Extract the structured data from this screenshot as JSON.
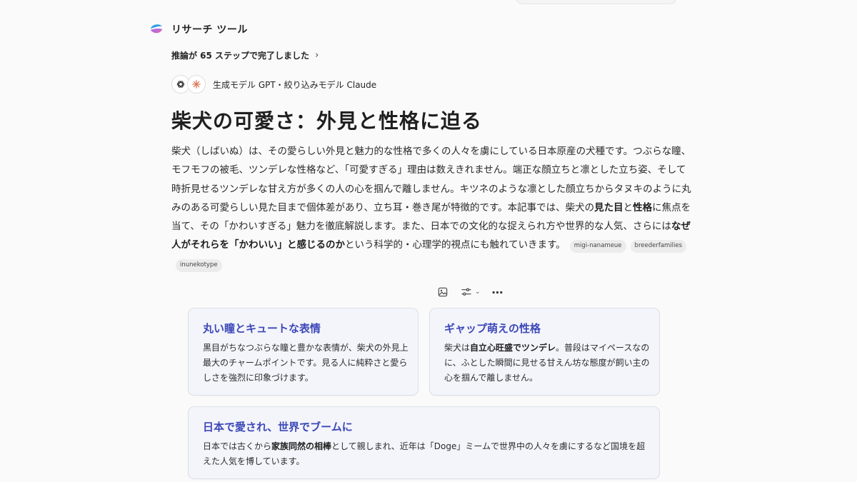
{
  "tool": {
    "title": "リサーチ ツール",
    "logo_icon": "copilot-logo-icon"
  },
  "steps": {
    "text": "推論が 65 ステップで完了しました",
    "chevron": "›"
  },
  "models": {
    "icons": [
      "openai-icon",
      "claude-icon"
    ],
    "text": "生成モデル GPT・絞り込みモデル Claude"
  },
  "article": {
    "title": "柴犬の可愛さ：外見と性格に迫る",
    "body": {
      "p1": "柴犬（しばいぬ）は、その愛らしい外見と魅力的な性格で多くの人々を虜にしている日本原産の犬種です。つぶらな瞳、モフモフの被毛、ツンデレな性格など、「可愛すぎる」理由は数えきれません。端正な顔立ちと凛とした立ち姿、そして時折見せるツンデレな甘え方が多くの人の心を掴んで離しません。キツネのような凛とした顔立ちからタヌキのように丸みのある可愛らしい見た目まで個体差があり、立ち耳・巻き尾が特徴的です。本記事では、柴犬の",
      "b1": "見た目",
      "p2": "と",
      "b2": "性格",
      "p3": "に焦点を当て、その「かわいすぎる」魅力を徹底解説します。また、日本での文化的な捉えられ方や世界的な人気、さらには",
      "b3": "なぜ人がそれらを「かわいい」と感じるのか",
      "p4": "という科学的・心理学的視点にも触れていきます。"
    },
    "sources": [
      "migi-nanameue",
      "breederfamilies",
      "inunekotype"
    ]
  },
  "actions": {
    "image_icon": "image-icon",
    "adjust_icon": "sliders-icon",
    "more_icon": "more-horizontal-icon",
    "chevron": "⌄",
    "more_glyph": "⋯"
  },
  "cards": {
    "card1": {
      "title": "丸い瞳とキュートな表情",
      "text": "黒目がちなつぶらな瞳と豊かな表情が、柴犬の外見上最大のチャームポイントです。見る人に純粋さと愛らしさを強烈に印象づけます。"
    },
    "card2": {
      "title": "ギャップ萌えの性格",
      "t1": "柴犬は",
      "b1": "自立心旺盛でツンデレ",
      "t2": "。普段はマイペースなのに、ふとした瞬間に見せる甘えん坊な態度が飼い主の心を掴んで離しません。"
    },
    "card3": {
      "title": "日本で愛され、世界でブームに",
      "t1": "日本では古くから",
      "b1": "家族同然の相棒",
      "t2": "として親しまれ、近年は「Doge」ミームで世界中の人々を虜にするなど国境を超えた人気を博しています。"
    }
  },
  "colors": {
    "accent": "#3c48b8",
    "card_bg": "#f4f5fb",
    "page_bg": "#fafafa",
    "claude": "#d97757"
  }
}
